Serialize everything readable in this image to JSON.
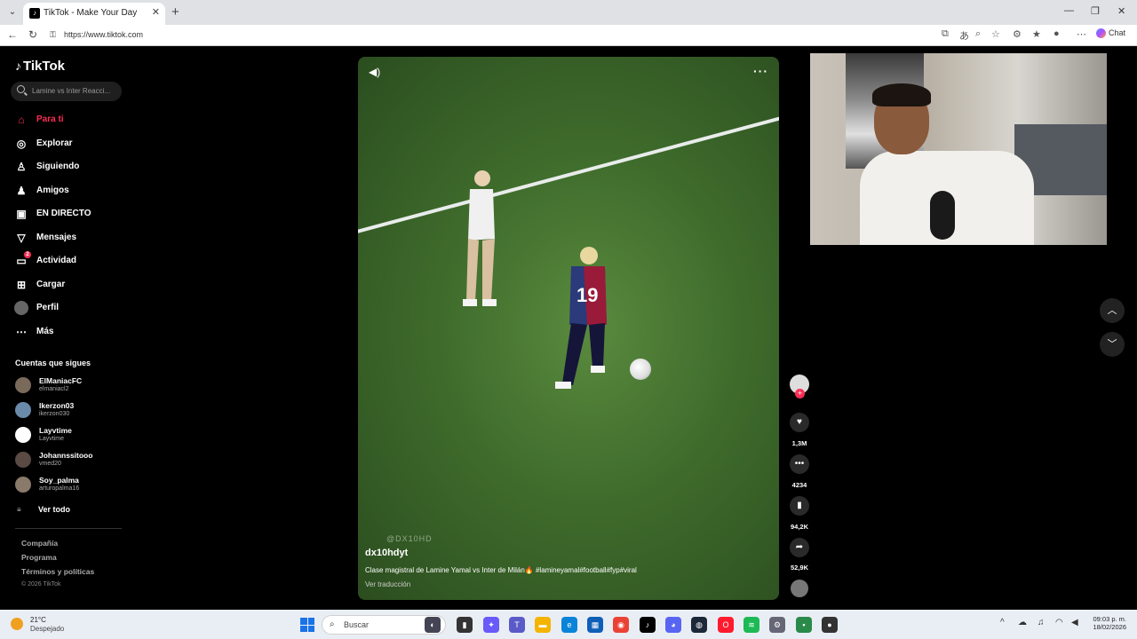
{
  "browser": {
    "tab_title": "TikTok - Make Your Day",
    "url": "https://www.tiktok.com",
    "chat_label": "Chat"
  },
  "sidebar": {
    "logo": "TikTok",
    "search_placeholder": "Lamine vs Inter Reacci...",
    "nav": [
      {
        "label": "Para ti",
        "icon": "home-icon"
      },
      {
        "label": "Explorar",
        "icon": "compass-icon"
      },
      {
        "label": "Siguiendo",
        "icon": "following-icon"
      },
      {
        "label": "Amigos",
        "icon": "friends-icon"
      },
      {
        "label": "EN DIRECTO",
        "icon": "live-icon"
      },
      {
        "label": "Mensajes",
        "icon": "send-icon"
      },
      {
        "label": "Actividad",
        "icon": "activity-icon",
        "badge": "2"
      },
      {
        "label": "Cargar",
        "icon": "upload-icon"
      },
      {
        "label": "Perfil",
        "icon": "avatar-icon"
      },
      {
        "label": "Más",
        "icon": "more-icon"
      }
    ],
    "following_title": "Cuentas que sigues",
    "following": [
      {
        "name": "ElManiacFC",
        "handle": "elmaniacl2",
        "color": "#7a6a5a"
      },
      {
        "name": "Ikerzon03",
        "handle": "ikerzon030",
        "color": "#6a8aaa"
      },
      {
        "name": "Layvtime",
        "handle": "Layvtime",
        "color": "#ffffff"
      },
      {
        "name": "Johannssitooo",
        "handle": "vmed20",
        "color": "#5a4a44"
      },
      {
        "name": "Soy_palma",
        "handle": "arturopalma16",
        "color": "#8a7a6a"
      }
    ],
    "see_all": "Ver todo",
    "footer": [
      "Compañía",
      "Programa",
      "Términos y políticas"
    ],
    "copyright": "© 2026 TikTok"
  },
  "video": {
    "watermark": "@DX10HD",
    "author": "dx10hdyt",
    "caption": "Clase magistral de Lamine Yamal vs Inter de Milán🔥 #lamineyamal#football#fyp#viral",
    "translate": "Ver traducción",
    "jersey_number": "19"
  },
  "actions": {
    "likes": "1,3M",
    "comments": "4234",
    "saves": "94,2K",
    "shares": "52,9K"
  },
  "taskbar": {
    "temp": "21°C",
    "weather": "Despejado",
    "search_placeholder": "Buscar",
    "time": "09:03 p. m.",
    "date": "18/02/2026"
  }
}
